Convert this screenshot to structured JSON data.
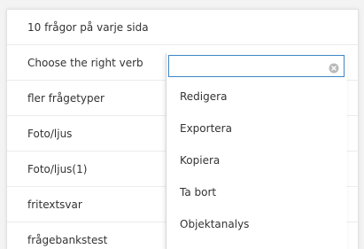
{
  "list": {
    "rows": [
      {
        "label": "10 frågor på varje sida"
      },
      {
        "label": "Choose the right verb"
      },
      {
        "label": "fler frågetyper"
      },
      {
        "label": "Foto/ljus"
      },
      {
        "label": "Foto/ljus(1)"
      },
      {
        "label": "fritextsvar"
      },
      {
        "label": "frågebankstest"
      }
    ]
  },
  "dropdown": {
    "search": {
      "value": "",
      "placeholder": ""
    },
    "clear_icon": "clear-circle-icon",
    "items": [
      {
        "label": "Redigera"
      },
      {
        "label": "Exportera"
      },
      {
        "label": "Kopiera"
      },
      {
        "label": "Ta bort"
      },
      {
        "label": "Objektanalys"
      }
    ]
  },
  "colors": {
    "focus_border": "#3d86c6",
    "text": "#333333",
    "divider": "#ececec"
  }
}
